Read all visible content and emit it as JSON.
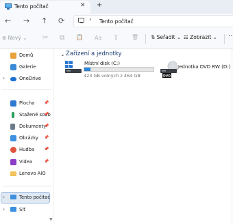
{
  "window": {
    "tab_title": "Tento počítač",
    "close_glyph": "✕",
    "add_tab_glyph": "+"
  },
  "navigation": {
    "back": "←",
    "forward": "→",
    "up": "↑",
    "refresh": "⟳"
  },
  "address_bar": {
    "chevron": "›",
    "path": "Tento počítač"
  },
  "toolbar": {
    "new_label": "⊕ Nový ⌄",
    "cut_icon": "✂",
    "copy_icon": "⧉",
    "paste_icon": "📋",
    "rename_icon": "Aa",
    "share_icon": "⇪",
    "delete_icon": "🗑",
    "sort_label": "⇅ Seřadit ⌄",
    "view_label": "☷ Zobrazit ⌄",
    "more_label": "···"
  },
  "sidebar": {
    "items": [
      {
        "label": "Domů",
        "icon": "home-icon",
        "color": "#e8a23c"
      },
      {
        "label": "Galerie",
        "icon": "gallery-icon",
        "color": "#3a8ad8"
      },
      {
        "label": "OneDrive",
        "icon": "onedrive-icon",
        "color": "#1e6fd0",
        "chevron": "›"
      },
      {
        "label": "Plocha",
        "icon": "desktop-icon",
        "color": "#2f7ad1",
        "pin": "📌"
      },
      {
        "label": "Stažené soub",
        "icon": "download-icon",
        "color": "#2a9d5c",
        "pin": "📌"
      },
      {
        "label": "Dokumenty",
        "icon": "documents-icon",
        "color": "#6c7a89",
        "pin": "📌"
      },
      {
        "label": "Obrázky",
        "icon": "pictures-icon",
        "color": "#3d8fe0",
        "pin": "📌"
      },
      {
        "label": "Hudba",
        "icon": "music-icon",
        "color": "#e0533d",
        "pin": "📌"
      },
      {
        "label": "Videa",
        "icon": "videos-icon",
        "color": "#8a3fc6",
        "pin": "📌"
      },
      {
        "label": "Lenovo AIO",
        "icon": "folder-icon",
        "color": "#f1c35a"
      },
      {
        "label": "Tento počítač",
        "icon": "this-pc-icon",
        "color": "#3d8fe0",
        "chevron": "›"
      },
      {
        "label": "Síť",
        "icon": "network-icon",
        "color": "#3d8fe0",
        "chevron": "›"
      }
    ]
  },
  "content": {
    "group_chevron": "⌄",
    "group_header": "Zařízení a jednotky",
    "drives": [
      {
        "name": "Místní disk (C:)",
        "space": "423 GB volných z 464 GB",
        "used_fraction": 0.088
      },
      {
        "name": "Jednotka DVD RW (D:)",
        "badge": "DVD"
      }
    ]
  },
  "colors": {
    "accent": "#2a84d8",
    "selected_bg": "#dfe8f3"
  }
}
